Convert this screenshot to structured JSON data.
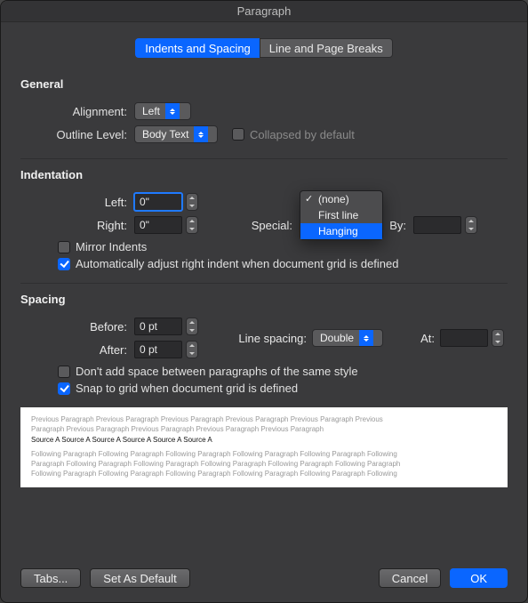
{
  "window_title": "Paragraph",
  "tabs": {
    "indents_spacing": "Indents and Spacing",
    "line_page_breaks": "Line and Page Breaks"
  },
  "general": {
    "heading": "General",
    "alignment_label": "Alignment:",
    "alignment_value": "Left",
    "outline_label": "Outline Level:",
    "outline_value": "Body Text",
    "collapsed_label": "Collapsed by default"
  },
  "indentation": {
    "heading": "Indentation",
    "left_label": "Left:",
    "left_value": "0\"",
    "right_label": "Right:",
    "right_value": "0\"",
    "special_label": "Special:",
    "by_label": "By:",
    "by_value": "",
    "options": {
      "none": "(none)",
      "first_line": "First line",
      "hanging": "Hanging"
    },
    "mirror_label": "Mirror Indents",
    "auto_adjust_label": "Automatically adjust right indent when document grid is defined"
  },
  "spacing": {
    "heading": "Spacing",
    "before_label": "Before:",
    "before_value": "0 pt",
    "after_label": "After:",
    "after_value": "0 pt",
    "line_spacing_label": "Line spacing:",
    "line_spacing_value": "Double",
    "at_label": "At:",
    "at_value": "",
    "dont_add_label": "Don't add space between paragraphs of the same style",
    "snap_label": "Snap to grid when document grid is defined"
  },
  "preview": {
    "prev_line": "Previous Paragraph Previous Paragraph Previous Paragraph Previous Paragraph Previous Paragraph Previous",
    "prev_line2": "Paragraph Previous Paragraph Previous Paragraph Previous Paragraph Previous Paragraph",
    "sample": "Source A Source A Source A Source A Source A Source A",
    "foll_line": "Following Paragraph Following Paragraph Following Paragraph Following Paragraph Following Paragraph Following",
    "foll_line2": "Paragraph Following Paragraph Following Paragraph Following Paragraph Following Paragraph Following Paragraph",
    "foll_line3": "Following Paragraph Following Paragraph Following Paragraph Following Paragraph Following Paragraph Following"
  },
  "buttons": {
    "tabs": "Tabs...",
    "default": "Set As Default",
    "cancel": "Cancel",
    "ok": "OK"
  }
}
